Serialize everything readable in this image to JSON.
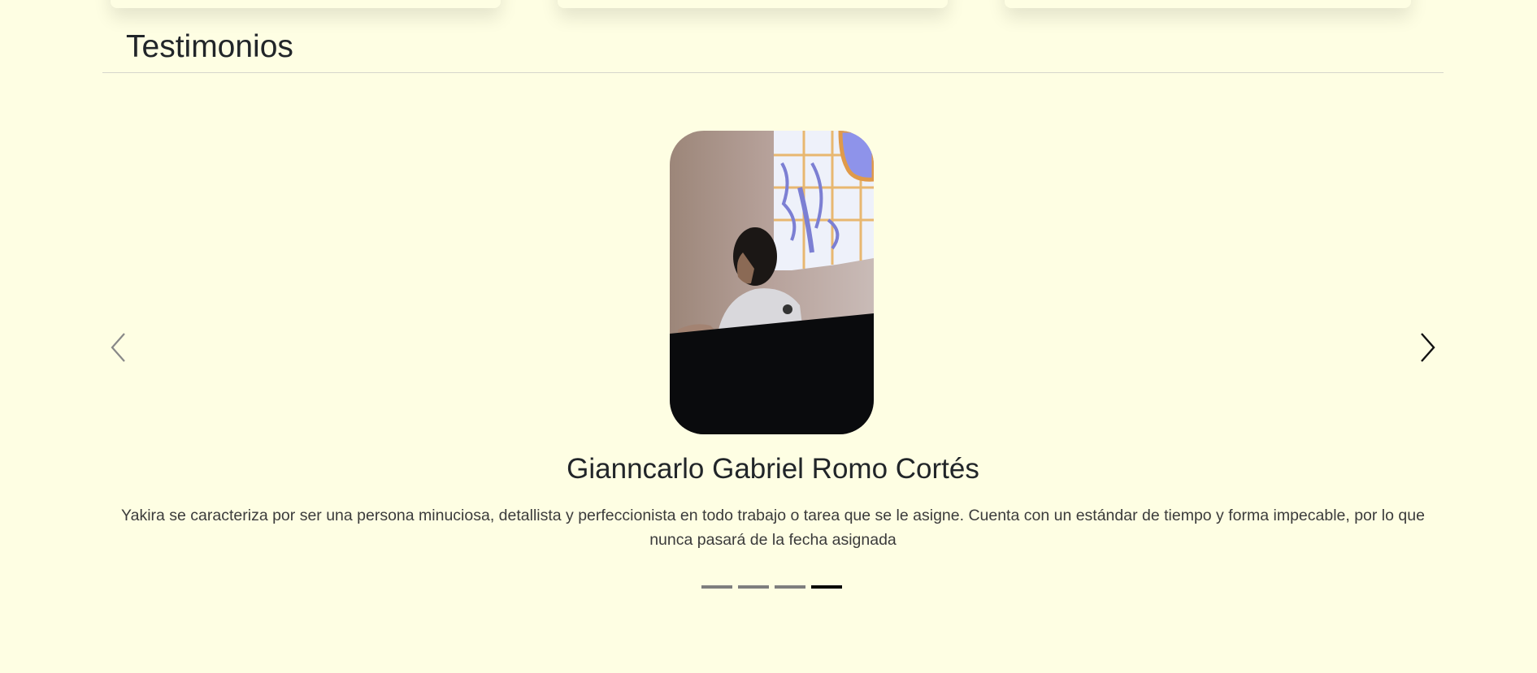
{
  "section": {
    "title": "Testimonios"
  },
  "testimonial": {
    "name": "Gianncarlo Gabriel Romo Cortés",
    "quote": "Yakira se caracteriza por ser una persona minuciosa, detallista y perfeccionista en todo trabajo o tarea que se le asigne. Cuenta con un estándar de tiempo y forma impecable, por lo que nunca pasará de la fecha asignada"
  },
  "carousel": {
    "prev_icon": "chevron-left-icon",
    "next_icon": "chevron-right-icon",
    "slide_count": 4,
    "active_index": 3
  },
  "colors": {
    "background": "#fefee3",
    "text": "#212529",
    "indicator": "#7e7e7e",
    "indicator_active": "#000000"
  }
}
